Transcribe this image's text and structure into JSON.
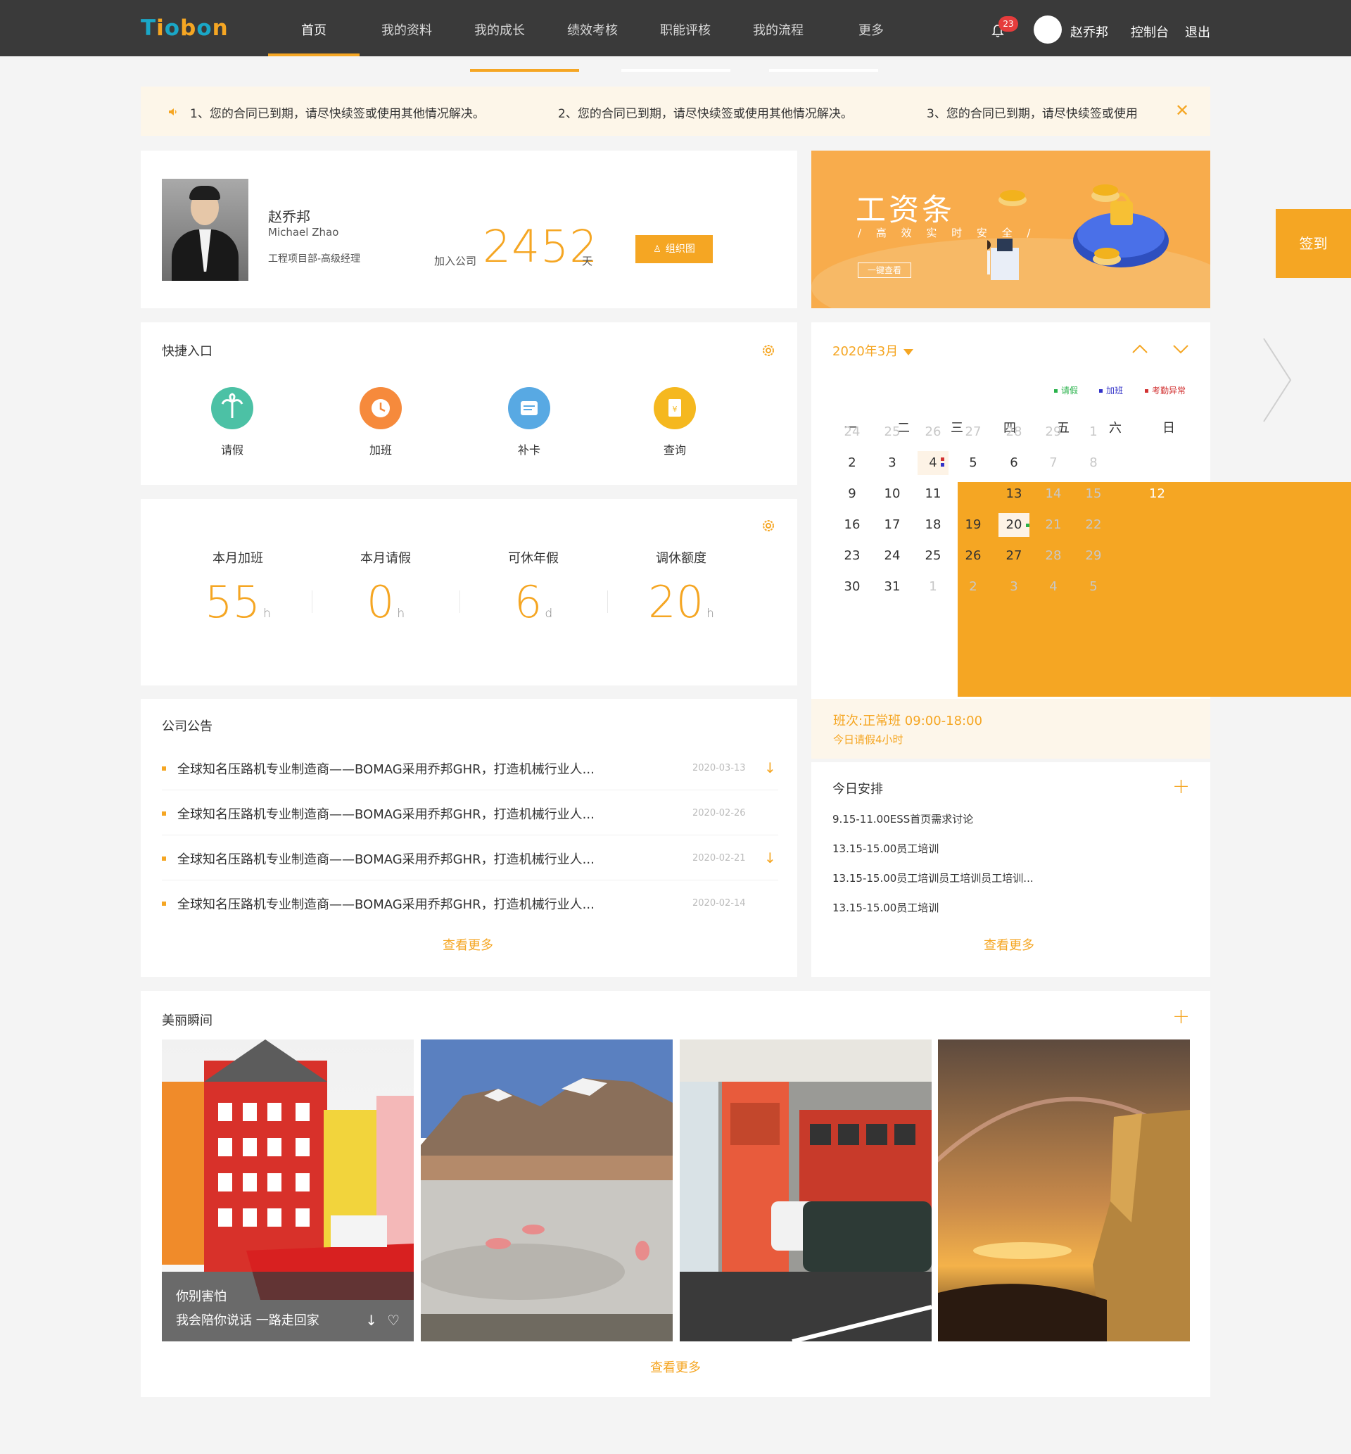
{
  "colors": {
    "accent": "#f5a623",
    "header": "#3a3a3a",
    "leave": "#29b24b",
    "overtime": "#3232c8",
    "abnormal": "#d23232"
  },
  "header": {
    "logo_letters": [
      "T",
      "i",
      "o",
      "b",
      "o",
      "n"
    ],
    "nav": [
      "首页",
      "我的资料",
      "我的成长",
      "绩效考核",
      "职能评核",
      "我的流程",
      "更多"
    ],
    "active_nav": 0,
    "notification_count": "23",
    "user_name": "赵乔邦",
    "console": "控制台",
    "logout": "退出"
  },
  "notice": {
    "items": [
      "1、您的合同已到期，请尽快续签或使用其他情况解决。",
      "2、您的合同已到期，请尽快续签或使用其他情况解决。",
      "3、您的合同已到期，请尽快续签或使用"
    ],
    "close": "✕"
  },
  "profile": {
    "name": "赵乔邦",
    "english_name": "Michael Zhao",
    "dept": "工程项目部-高级经理",
    "join_label": "加入公司",
    "join_days": "2452",
    "days_unit": "天",
    "org_button": "组织图"
  },
  "salary": {
    "title": "工资条",
    "subtitle": "/ 高 效 实 时 安 全 /",
    "button": "一键查看"
  },
  "signin": "签到",
  "quick": {
    "title": "快捷入口",
    "items": [
      {
        "label": "请假",
        "color": "#4cc1a5",
        "icon": "palm-tree-icon"
      },
      {
        "label": "加班",
        "color": "#f68a3c",
        "icon": "clock-icon"
      },
      {
        "label": "补卡",
        "color": "#58a9e3",
        "icon": "card-icon"
      },
      {
        "label": "查询",
        "color": "#f5b81f",
        "icon": "document-icon"
      }
    ]
  },
  "stats": [
    {
      "label": "本月加班",
      "value": "55",
      "unit": "h"
    },
    {
      "label": "本月请假",
      "value": "0",
      "unit": "h"
    },
    {
      "label": "可休年假",
      "value": "6",
      "unit": "d"
    },
    {
      "label": "调休额度",
      "value": "20",
      "unit": "h"
    }
  ],
  "announcements": {
    "title": "公司公告",
    "items": [
      {
        "text": "全球知名压路机专业制造商——BOMAG采用乔邦GHR，打造机械行业人...",
        "date": "2020-03-13",
        "download": true
      },
      {
        "text": "全球知名压路机专业制造商——BOMAG采用乔邦GHR，打造机械行业人...",
        "date": "2020-02-26",
        "download": false
      },
      {
        "text": "全球知名压路机专业制造商——BOMAG采用乔邦GHR，打造机械行业人...",
        "date": "2020-02-21",
        "download": true
      },
      {
        "text": "全球知名压路机专业制造商——BOMAG采用乔邦GHR，打造机械行业人...",
        "date": "2020-02-14",
        "download": false
      }
    ],
    "more": "查看更多"
  },
  "calendar": {
    "month": "2020年3月",
    "legend": [
      {
        "label": "请假",
        "color": "#29b24b"
      },
      {
        "label": "加班",
        "color": "#3232c8"
      },
      {
        "label": "考勤异常",
        "color": "#d23232"
      }
    ],
    "weekdays": [
      "一",
      "二",
      "三",
      "四",
      "五",
      "六",
      "日"
    ],
    "weeks": [
      [
        "24",
        "25",
        "26",
        "27",
        "28",
        "29",
        "1"
      ],
      [
        "2",
        "3",
        "4",
        "5",
        "6",
        "7",
        "8"
      ],
      [
        "9",
        "10",
        "11",
        "12",
        "13",
        "14",
        "15"
      ],
      [
        "16",
        "17",
        "18",
        "19",
        "20",
        "21",
        "22"
      ],
      [
        "23",
        "24",
        "25",
        "26",
        "27",
        "28",
        "29"
      ],
      [
        "30",
        "31",
        "1",
        "2",
        "3",
        "4",
        "5"
      ]
    ],
    "today": "12",
    "shift": "班次:正常班 09:00-18:00",
    "shift_note": "今日请假4小时"
  },
  "today_schedule": {
    "title": "今日安排",
    "items": [
      "9.15-11.00ESS首页需求讨论",
      "13.15-15.00员工培训",
      "13.15-15.00员工培训员工培训员工培训...",
      "13.15-15.00员工培训"
    ],
    "more": "查看更多"
  },
  "gallery": {
    "title": "美丽瞬间",
    "caption_line1": "你别害怕",
    "caption_line2": "我会陪你说话 一路走回家",
    "more": "查看更多"
  }
}
